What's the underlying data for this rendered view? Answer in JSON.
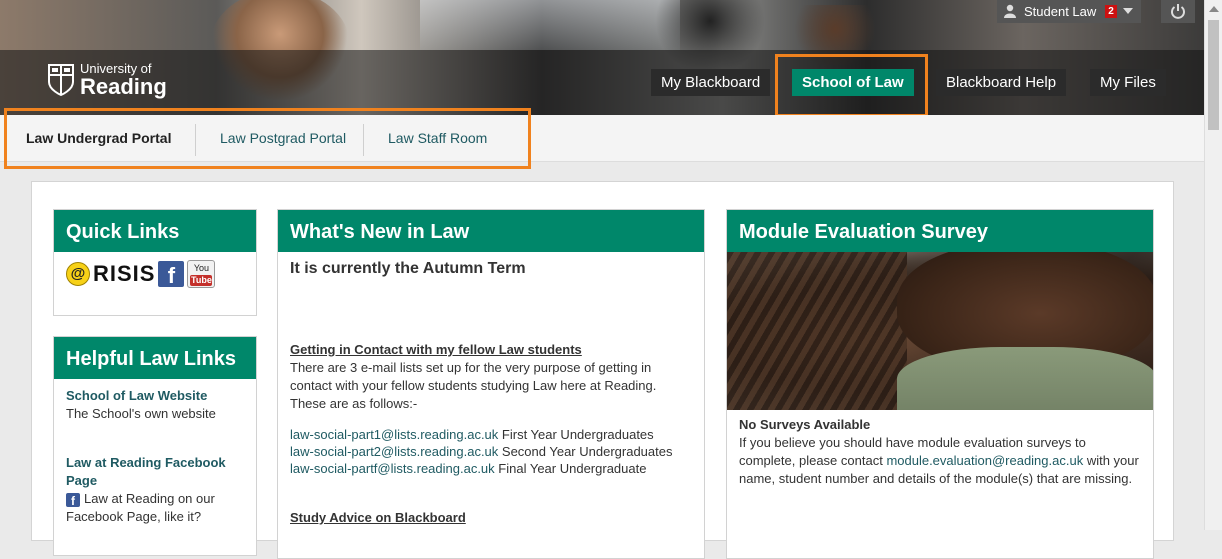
{
  "header": {
    "logo": {
      "line1": "University of",
      "line2": "Reading"
    },
    "user": {
      "name": "Student Law",
      "notifications": "2"
    },
    "tabs": [
      {
        "label": "My Blackboard"
      },
      {
        "label": "School of Law"
      },
      {
        "label": "Blackboard Help"
      },
      {
        "label": "My Files"
      }
    ]
  },
  "subtabs": [
    {
      "label": "Law Undergrad Portal"
    },
    {
      "label": "Law Postgrad Portal"
    },
    {
      "label": "Law Staff Room"
    }
  ],
  "quick_links": {
    "title": "Quick Links",
    "risis": "RISIS",
    "youtube_top": "You",
    "youtube_bottom": "Tube"
  },
  "helpful_links": {
    "title": "Helpful Law Links",
    "items": [
      {
        "title": "School of Law Website",
        "desc": "The School's own website"
      },
      {
        "title": "Law at Reading Facebook Page",
        "desc": "Law at Reading on our Facebook Page, like it?"
      }
    ]
  },
  "whats_new": {
    "title": "What's New in Law",
    "term": "It is currently the Autumn Term",
    "section1_title": "Getting in Contact with my fellow Law students",
    "section1_body": "There are 3 e-mail lists set up for the very purpose of getting in contact with your fellow students studying Law here at Reading. These are as follows:-",
    "emails": [
      {
        "address": "law-social-part1@lists.reading.ac.uk",
        "desc": "First Year Undergraduates"
      },
      {
        "address": "law-social-part2@lists.reading.ac.uk",
        "desc": "Second Year Undergraduates"
      },
      {
        "address": "law-social-partf@lists.reading.ac.uk",
        "desc": "Final Year Undergraduate"
      }
    ],
    "section2_title": "Study Advice on Blackboard"
  },
  "survey": {
    "title": "Module Evaluation Survey",
    "status": "No Surveys Available",
    "text_before": "If you believe you should have module evaluation surveys to complete, please contact",
    "email": "module.evaluation@reading.ac.uk",
    "text_after": "with your name, student number and details of the module(s) that are missing."
  },
  "colors": {
    "accent": "#00876a",
    "highlight": "#f0821e",
    "link": "#1f5a62"
  }
}
